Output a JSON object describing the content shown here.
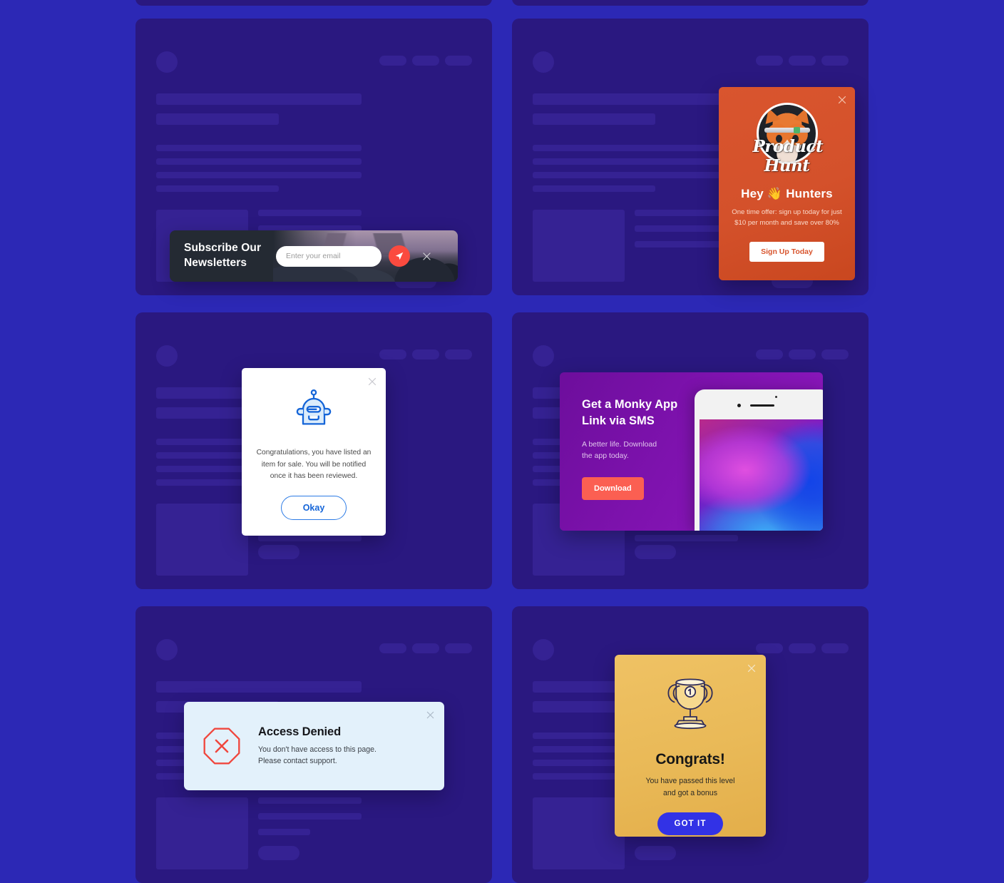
{
  "theme": {
    "page_background": "#2c28b5",
    "card_background": "#2a1880",
    "skeleton_block": "#352293",
    "accent_red": "#fb4a3f",
    "accent_blue": "#3232e6"
  },
  "cards": [
    {
      "id": "card-top-left-partial"
    },
    {
      "id": "card-top-right-partial"
    },
    {
      "id": "card-r1c1"
    },
    {
      "id": "card-r1c2"
    },
    {
      "id": "card-r2c1"
    },
    {
      "id": "card-r2c2"
    },
    {
      "id": "card-r3c1"
    },
    {
      "id": "card-r3c2"
    }
  ],
  "subscribe_popup": {
    "title": "Subscribe Our\nNewsletters",
    "title_line1": "Subscribe Our",
    "title_line2": "Newsletters",
    "email_placeholder": "Enter your email",
    "email_value": "",
    "send_icon": "paper-plane-icon",
    "close_icon": "close-icon",
    "background_color": "#242a33",
    "send_button_color": "#fb4a3f"
  },
  "producthunt_popup": {
    "logo_wordmark": "Product Hunt",
    "heading": "Hey 👋 Hunters",
    "heading_prefix": "Hey",
    "heading_emoji": "👋",
    "heading_suffix": "Hunters",
    "subtext": "One time offer: sign up today for just $10 per month and save over 80%",
    "button_label": "Sign Up Today",
    "close_icon": "close-icon",
    "background_color": "#d9552e",
    "button_text_color": "#d8552e"
  },
  "robot_modal": {
    "icon": "robot-icon",
    "message": "Congratulations, you have listed an item for sale. You will be notified once it has been reviewed.",
    "button_label": "Okay",
    "close_icon": "close-icon",
    "accent_color": "#2c7be5"
  },
  "sms_popup": {
    "title_line1": "Get a Monky App",
    "title_line2": "Link via SMS",
    "subtext_line1": "A better life. Download",
    "subtext_line2": "the app today.",
    "button_label": "Download",
    "device_image": "smartphone-mockup",
    "background_color": "#7e12ae",
    "button_color": "#fb5f52"
  },
  "access_denied_alert": {
    "icon": "octagon-x-icon",
    "title": "Access Denied",
    "text_line1": "You don't have access to this page.",
    "text_line2": "Please contact support.",
    "close_icon": "close-icon",
    "background_color": "#e3f1fb",
    "icon_color": "#f0473e"
  },
  "congrats_modal": {
    "icon": "trophy-icon",
    "title": "Congrats!",
    "text_line1": "You have passed this level",
    "text_line2": "and got a bonus",
    "button_label": "GOT IT",
    "close_icon": "close-icon",
    "background_color": "#e9b957",
    "button_color": "#3232e6"
  }
}
